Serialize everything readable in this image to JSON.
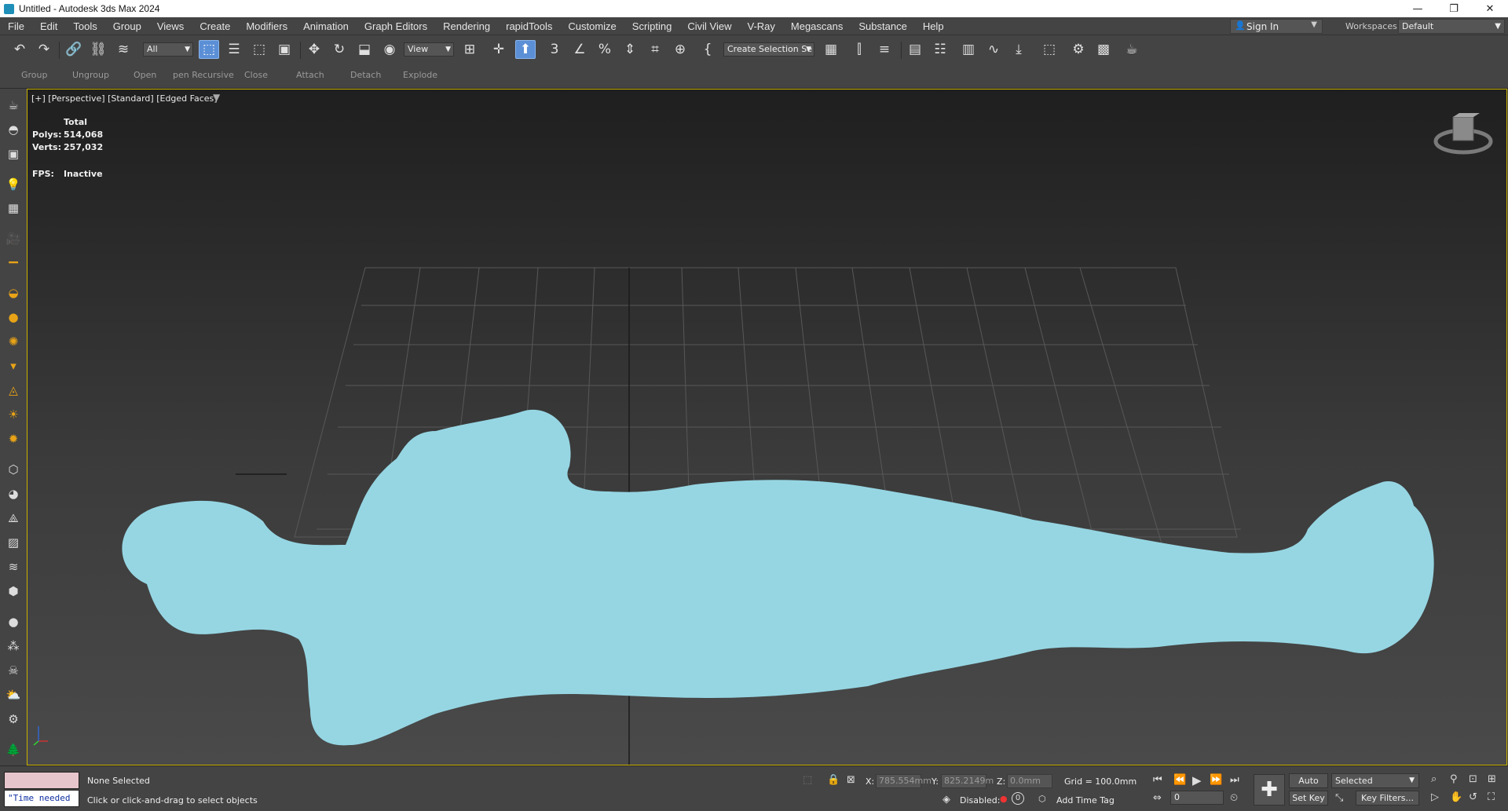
{
  "window": {
    "title": "Untitled - Autodesk 3ds Max 2024",
    "minimize_glyph": "—",
    "restore_glyph": "❐",
    "close_glyph": "✕"
  },
  "menu": [
    "File",
    "Edit",
    "Tools",
    "Group",
    "Views",
    "Create",
    "Modifiers",
    "Animation",
    "Graph Editors",
    "Rendering",
    "rapidTools",
    "Customize",
    "Scripting",
    "Civil View",
    "V-Ray",
    "Megascans",
    "Substance",
    "Help"
  ],
  "account": {
    "sign_in": "Sign In",
    "workspaces_label": "Workspaces:",
    "workspace": "Default"
  },
  "toolbar": {
    "selection_filter": "All",
    "ref_coord": "View",
    "named_selection": "Create Selection Se"
  },
  "ribbon": [
    "Group",
    "Ungroup",
    "Open",
    "pen Recursive",
    "Close",
    "Attach",
    "Detach",
    "Explode"
  ],
  "viewport": {
    "label": "[+] [Perspective] [Standard] [Edged Faces]",
    "stats_header": "Total",
    "polys_label": "Polys:",
    "polys_value": "514,068",
    "verts_label": "Verts:",
    "verts_value": "257,032",
    "fps_label": "FPS:",
    "fps_value": "Inactive",
    "model_color": "#96d6e3"
  },
  "status": {
    "maxscript_text": "\"Time needed",
    "selection": "None Selected",
    "prompt": "Click or click-and-drag to select objects",
    "x_label": "X:",
    "x_value": "785.554mm",
    "y_label": "Y:",
    "y_value": "825.2149m",
    "z_label": "Z:",
    "z_value": "0.0mm",
    "grid": "Grid = 100.0mm",
    "disabled_label": "Disabled:",
    "disabled_count": "0",
    "add_time_tag": "Add Time Tag",
    "auto_key": "Auto Key",
    "set_key": "Set Key",
    "key_mode": "Selected",
    "key_filters": "Key Filters...",
    "frame": "0"
  }
}
